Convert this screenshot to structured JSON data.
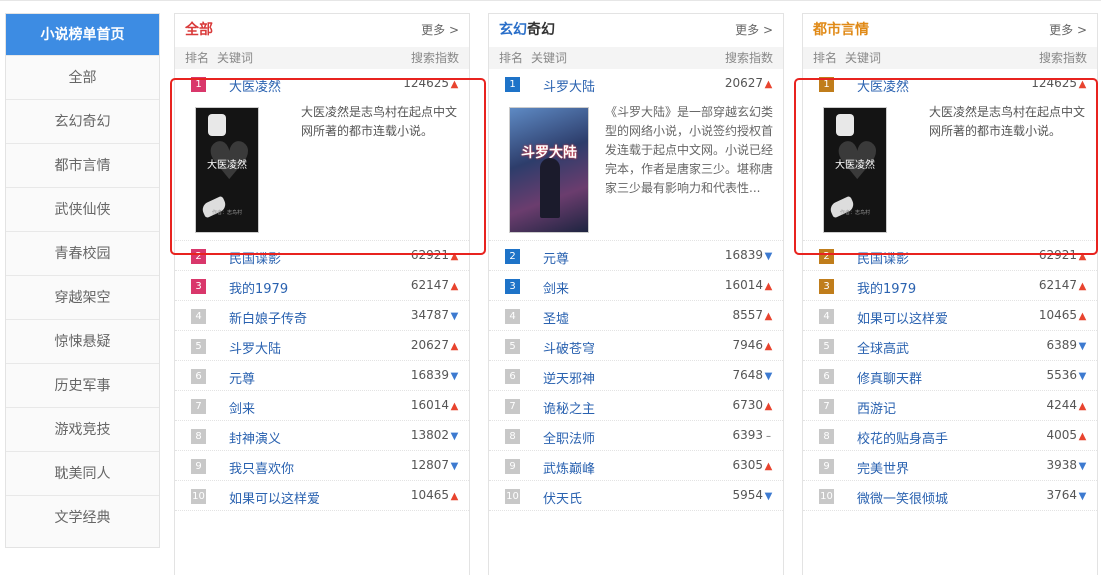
{
  "sidebar": {
    "items": [
      {
        "label": "小说榜单首页"
      },
      {
        "label": "全部"
      },
      {
        "label": "玄幻奇幻"
      },
      {
        "label": "都市言情"
      },
      {
        "label": "武侠仙侠"
      },
      {
        "label": "青春校园"
      },
      {
        "label": "穿越架空"
      },
      {
        "label": "惊悚悬疑"
      },
      {
        "label": "历史军事"
      },
      {
        "label": "游戏竞技"
      },
      {
        "label": "耽美同人"
      },
      {
        "label": "文学经典"
      }
    ]
  },
  "columns": {
    "rank": "排名",
    "keyword": "关键词",
    "index": "搜索指数"
  },
  "panels": [
    {
      "title": "全部",
      "more": "更多 >",
      "featured": {
        "rank": "1",
        "name": "大医凌然",
        "value": "124625",
        "trend": "up",
        "cover_title": "大医凌然",
        "cover_author": "作者：志鸟村",
        "desc": "大医凌然是志鸟村在起点中文网所著的都市连载小说。"
      },
      "rows": [
        {
          "rank": "2",
          "name": "民国谍影",
          "value": "62921",
          "trend": "up"
        },
        {
          "rank": "3",
          "name": "我的1979",
          "value": "62147",
          "trend": "up"
        },
        {
          "rank": "4",
          "name": "新白娘子传奇",
          "value": "34787",
          "trend": "down"
        },
        {
          "rank": "5",
          "name": "斗罗大陆",
          "value": "20627",
          "trend": "up"
        },
        {
          "rank": "6",
          "name": "元尊",
          "value": "16839",
          "trend": "down"
        },
        {
          "rank": "7",
          "name": "剑来",
          "value": "16014",
          "trend": "up"
        },
        {
          "rank": "8",
          "name": "封神演义",
          "value": "13802",
          "trend": "down"
        },
        {
          "rank": "9",
          "name": "我只喜欢你",
          "value": "12807",
          "trend": "down"
        },
        {
          "rank": "10",
          "name": "如果可以这样爱",
          "value": "10465",
          "trend": "up"
        }
      ]
    },
    {
      "title_a": "玄幻",
      "title_b": "奇幻",
      "more": "更多 >",
      "featured": {
        "rank": "1",
        "name": "斗罗大陆",
        "value": "20627",
        "trend": "up",
        "cover_title": "斗罗大陆",
        "desc": "《斗罗大陆》是一部穿越玄幻类型的网络小说，小说签约授权首发连载于起点中文网。小说已经完本，作者是唐家三少。堪称唐家三少最有影响力和代表性..."
      },
      "rows": [
        {
          "rank": "2",
          "name": "元尊",
          "value": "16839",
          "trend": "down"
        },
        {
          "rank": "3",
          "name": "剑来",
          "value": "16014",
          "trend": "up"
        },
        {
          "rank": "4",
          "name": "圣墟",
          "value": "8557",
          "trend": "up"
        },
        {
          "rank": "5",
          "name": "斗破苍穹",
          "value": "7946",
          "trend": "up"
        },
        {
          "rank": "6",
          "name": "逆天邪神",
          "value": "7648",
          "trend": "down"
        },
        {
          "rank": "7",
          "name": "诡秘之主",
          "value": "6730",
          "trend": "up"
        },
        {
          "rank": "8",
          "name": "全职法师",
          "value": "6393",
          "trend": "flat"
        },
        {
          "rank": "9",
          "name": "武炼巅峰",
          "value": "6305",
          "trend": "up"
        },
        {
          "rank": "10",
          "name": "伏天氏",
          "value": "5954",
          "trend": "down"
        }
      ]
    },
    {
      "title_a": "都市",
      "title_b": "言情",
      "more": "更多 >",
      "featured": {
        "rank": "1",
        "name": "大医凌然",
        "value": "124625",
        "trend": "up",
        "cover_title": "大医凌然",
        "cover_author": "作者：志鸟村",
        "desc": "大医凌然是志鸟村在起点中文网所著的都市连载小说。"
      },
      "rows": [
        {
          "rank": "2",
          "name": "民国谍影",
          "value": "62921",
          "trend": "up"
        },
        {
          "rank": "3",
          "name": "我的1979",
          "value": "62147",
          "trend": "up"
        },
        {
          "rank": "4",
          "name": "如果可以这样爱",
          "value": "10465",
          "trend": "up"
        },
        {
          "rank": "5",
          "name": "全球高武",
          "value": "6389",
          "trend": "down"
        },
        {
          "rank": "6",
          "name": "修真聊天群",
          "value": "5536",
          "trend": "down"
        },
        {
          "rank": "7",
          "name": "西游记",
          "value": "4244",
          "trend": "up"
        },
        {
          "rank": "8",
          "name": "校花的贴身高手",
          "value": "4005",
          "trend": "up"
        },
        {
          "rank": "9",
          "name": "完美世界",
          "value": "3938",
          "trend": "down"
        },
        {
          "rank": "10",
          "name": "微微一笑很倾城",
          "value": "3764",
          "trend": "down"
        }
      ]
    }
  ],
  "colors": {
    "accent": "#3d8ce3",
    "highlight_box": "#e8231f",
    "trend_up": "#e8442f",
    "trend_down": "#3d7ad0"
  }
}
